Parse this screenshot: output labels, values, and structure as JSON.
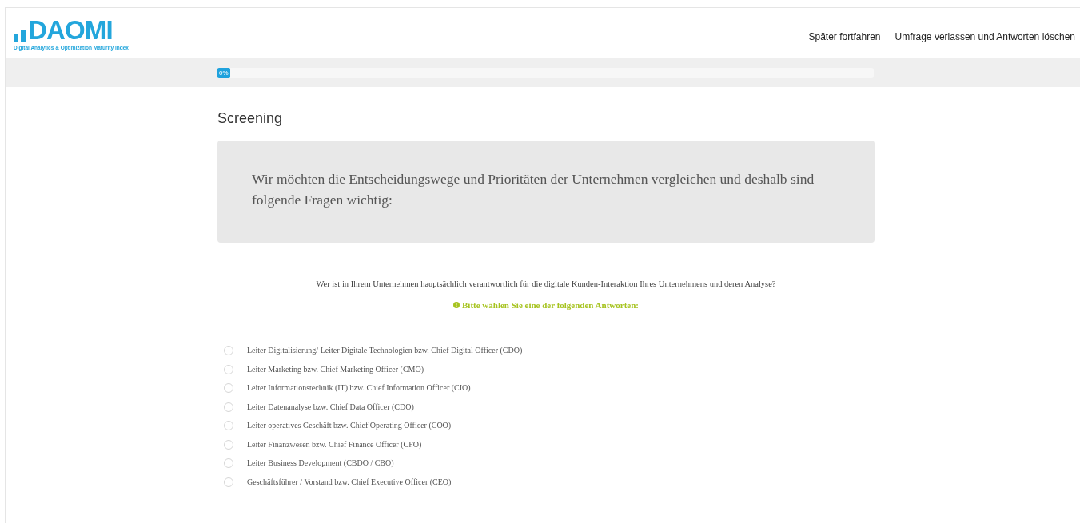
{
  "logo": {
    "name": "DAOMI",
    "tagline": "Digital Analytics & Optimization Maturity Index"
  },
  "nav": [
    "Später fortfahren",
    "Umfrage verlassen und Antworten löschen"
  ],
  "progress": {
    "label": "0%",
    "level": 0
  },
  "section_title": "Screening",
  "intro": "Wir möchten die Entscheidungswege und Prioritäten der Unternehmen vergleichen und deshalb sind folgende Fragen wichtig:",
  "question": "Wer ist in Ihrem Unternehmen hauptsächlich verantwortlich für die digitale Kunden-Interaktion Ihres Unternehmens und deren Analyse?",
  "hint": {
    "icon": "!",
    "text": "Bitte wählen Sie eine der folgenden Antworten:"
  },
  "options": [
    {
      "label": "Leiter Digitalisierung/ Leiter Digitale Technologien bzw. Chief Digital Officer (CDO)",
      "selected": false
    },
    {
      "label": "Leiter Marketing bzw. Chief Marketing Officer (CMO)",
      "selected": false
    },
    {
      "label": "Leiter Informationstechnik (IT) bzw. Chief Information Officer (CIO)",
      "selected": false
    },
    {
      "label": "Leiter Datenanalyse bzw. Chief Data Officer (CDO)",
      "selected": false
    },
    {
      "label": "Leiter operatives Geschäft bzw. Chief Operating Officer (COO)",
      "selected": false
    },
    {
      "label": "Leiter Finanzwesen bzw. Chief Finance Officer (CFO)",
      "selected": false
    },
    {
      "label": "Leiter Business Development (CBDO / CBO)",
      "selected": false
    },
    {
      "label": "Geschäftsführer / Vorstand bzw. Chief Executive Officer (CEO)",
      "selected": false
    }
  ]
}
